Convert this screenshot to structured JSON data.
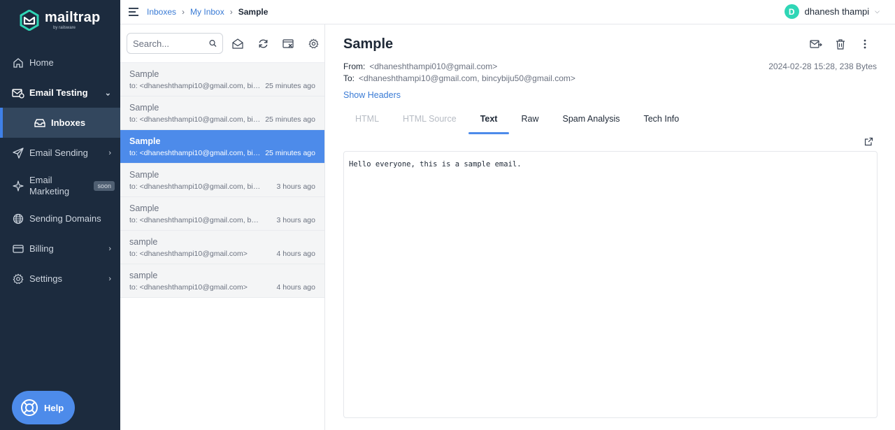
{
  "brand": {
    "name": "mailtrap",
    "sub": "by railsware",
    "accent": "#2fd6b6"
  },
  "sidebar": {
    "items": [
      {
        "label": "Home",
        "icon": "home-icon"
      },
      {
        "label": "Email Testing",
        "icon": "email-testing-icon"
      },
      {
        "label": "Inboxes",
        "icon": "inbox-icon"
      },
      {
        "label": "Email Sending",
        "icon": "send-icon"
      },
      {
        "label": "Email Marketing",
        "icon": "sparkle-icon",
        "badge": "soon"
      },
      {
        "label": "Sending Domains",
        "icon": "globe-icon"
      },
      {
        "label": "Billing",
        "icon": "billing-icon"
      },
      {
        "label": "Settings",
        "icon": "gear-icon"
      }
    ],
    "help_label": "Help"
  },
  "breadcrumb": {
    "items": [
      "Inboxes",
      "My Inbox"
    ],
    "current": "Sample"
  },
  "user": {
    "initial": "D",
    "name": "dhanesh thampi"
  },
  "search": {
    "placeholder": "Search..."
  },
  "messages": [
    {
      "subject": "Sample",
      "to": "to: <dhaneshthampi10@gmail.com, bin...",
      "time": "25 minutes ago"
    },
    {
      "subject": "Sample",
      "to": "to: <dhaneshthampi10@gmail.com, bin...",
      "time": "25 minutes ago"
    },
    {
      "subject": "Sample",
      "to": "to: <dhaneshthampi10@gmail.com, bin...",
      "time": "25 minutes ago"
    },
    {
      "subject": "Sample",
      "to": "to: <dhaneshthampi10@gmail.com, bincy...",
      "time": "3 hours ago"
    },
    {
      "subject": "Sample",
      "to": "to: <dhaneshthampi10@gmail.com, benny...",
      "time": "3 hours ago"
    },
    {
      "subject": "sample",
      "to": "to: <dhaneshthampi10@gmail.com>",
      "time": "4 hours ago"
    },
    {
      "subject": "sample",
      "to": "to: <dhaneshthampi10@gmail.com>",
      "time": "4 hours ago"
    }
  ],
  "detail": {
    "subject": "Sample",
    "from_label": "From:",
    "from": "<dhaneshthampi010@gmail.com>",
    "to_label": "To:",
    "to": "<dhaneshthampi10@gmail.com, bincybiju50@gmail.com>",
    "meta": "2024-02-28 15:28, 238 Bytes",
    "show_headers": "Show Headers",
    "tabs": [
      "HTML",
      "HTML Source",
      "Text",
      "Raw",
      "Spam Analysis",
      "Tech Info"
    ],
    "active_tab": "Text",
    "body": "Hello everyone, this is a sample email."
  }
}
